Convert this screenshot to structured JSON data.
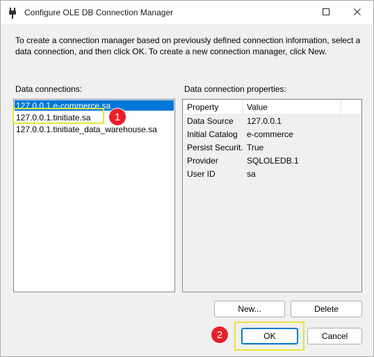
{
  "window": {
    "title": "Configure OLE DB Connection Manager",
    "icon": "plug-connector-icon"
  },
  "instructions": "To create a connection manager based on previously defined connection information, select a data connection, and then click OK. To create a new connection manager, click New.",
  "data_connections": {
    "label": "Data connections:",
    "items": [
      {
        "label": "127.0.0.1.e-commerce.sa",
        "selected": true
      },
      {
        "label": "127.0.0.1.tinitiate.sa",
        "selected": false
      },
      {
        "label": "127.0.0.1.tinitiate_data_warehouse.sa",
        "selected": false
      }
    ]
  },
  "properties": {
    "label": "Data connection properties:",
    "headers": [
      "Property",
      "Value"
    ],
    "rows": [
      {
        "property": "Data Source",
        "value": "127.0.0.1"
      },
      {
        "property": "Initial Catalog",
        "value": "e-commerce"
      },
      {
        "property": "Persist Securit...",
        "value": "True"
      },
      {
        "property": "Provider",
        "value": "SQLOLEDB.1"
      },
      {
        "property": "User ID",
        "value": "sa"
      }
    ]
  },
  "buttons": {
    "new": "New...",
    "delete": "Delete",
    "ok": "OK",
    "cancel": "Cancel"
  },
  "annotations": {
    "marker_1": "1",
    "marker_2": "2",
    "highlight_color": "#e6e43a",
    "marker_color": "#e8202a"
  },
  "colors": {
    "selection": "#0078d7"
  }
}
